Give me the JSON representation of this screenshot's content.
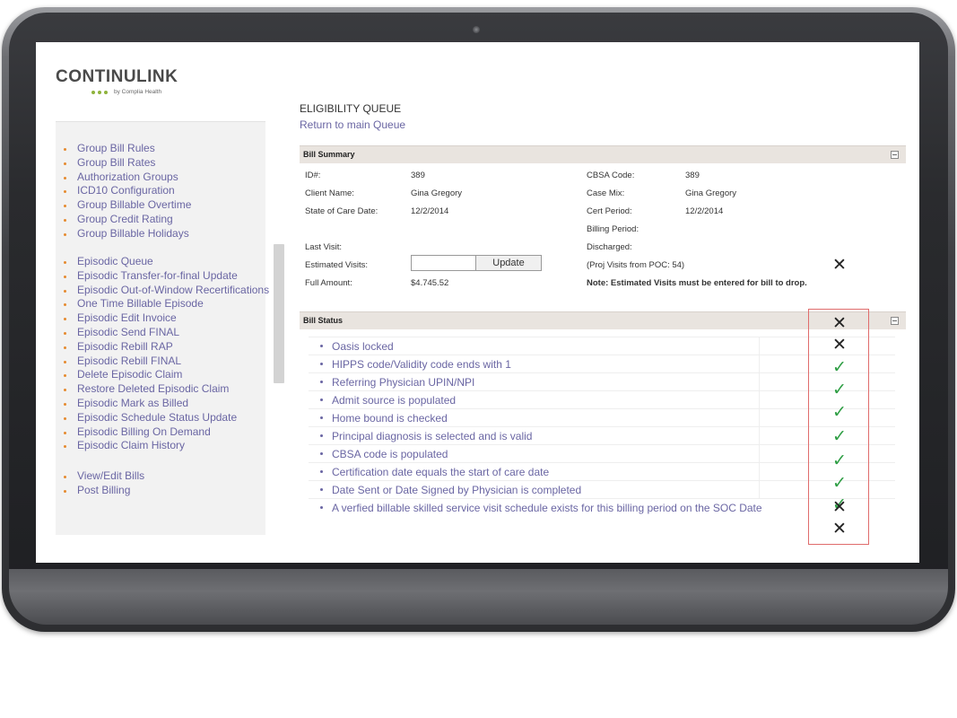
{
  "logo": {
    "name": "CONTINULINK",
    "tagline": "by Complia Health"
  },
  "sidebar": {
    "groups": [
      [
        "Group Bill Rules",
        "Group Bill Rates",
        "Authorization Groups",
        "ICD10 Configuration",
        "Group Billable Overtime",
        "Group Credit Rating",
        "Group Billable Holidays"
      ],
      [
        "Episodic Queue",
        "Episodic Transfer-for-final Update",
        "Episodic Out-of-Window Recertifications",
        "One Time Billable Episode",
        "Episodic Edit Invoice",
        "Episodic Send FINAL",
        "Episodic Rebill RAP",
        "Episodic Rebill FINAL",
        "Delete Episodic Claim",
        "Restore Deleted Episodic Claim",
        "Episodic Mark as Billed",
        "Episodic Schedule Status Update",
        "Episodic Billing On Demand",
        "Episodic Claim History"
      ],
      [
        "View/Edit Bills",
        "Post Billing"
      ]
    ]
  },
  "main": {
    "title": "ELIGIBILITY QUEUE",
    "return_link": "Return to main Queue"
  },
  "bill_summary": {
    "header": "Bill Summary",
    "id_label": "ID#:",
    "id_value": "389",
    "client_label": "Client Name:",
    "client_value": "Gina Gregory",
    "soc_label": "State of Care Date:",
    "soc_value": "12/2/2014",
    "last_visit_label": "Last Visit:",
    "est_visits_label": "Estimated Visits:",
    "update_label": "Update",
    "full_amount_label": "Full Amount:",
    "full_amount_value": "$4.745.52",
    "cbsa_label": "CBSA Code:",
    "cbsa_value": "389",
    "casemix_label": "Case Mix:",
    "casemix_value": "Gina Gregory",
    "cert_label": "Cert Period:",
    "cert_value": "12/2/2014",
    "billing_label": "Billing Period:",
    "discharged_label": "Discharged:",
    "proj_note": "(Proj Visits from POC: 54)",
    "note": "Note: Estimated Visits must be entered for bill to drop.",
    "summary_mark": "✕"
  },
  "bill_status": {
    "header": "Bill Status",
    "header_mark": "✕",
    "items": [
      {
        "text": "Oasis locked",
        "mark": "✕",
        "ok": false
      },
      {
        "text": "HIPPS code/Validity code ends with 1",
        "mark": "✓",
        "ok": true
      },
      {
        "text": "Referring Physician UPIN/NPI",
        "mark": "✓",
        "ok": true
      },
      {
        "text": "Admit source is populated",
        "mark": "✓",
        "ok": true
      },
      {
        "text": "Home bound is checked",
        "mark": "✓",
        "ok": true
      },
      {
        "text": "Principal diagnosis is selected and is valid",
        "mark": "✓",
        "ok": true
      },
      {
        "text": "CBSA code is populated",
        "mark": "✓",
        "ok": true
      },
      {
        "text": "Certification date equals the start of care date",
        "mark": "✓",
        "ok": true
      },
      {
        "text": "Date Sent or Date Signed by Physician is completed",
        "mark": "✕",
        "ok": false
      },
      {
        "text": "A verfied billable skilled service visit schedule exists for this billing period on the SOC Date",
        "mark": "✕",
        "ok": false
      }
    ]
  }
}
